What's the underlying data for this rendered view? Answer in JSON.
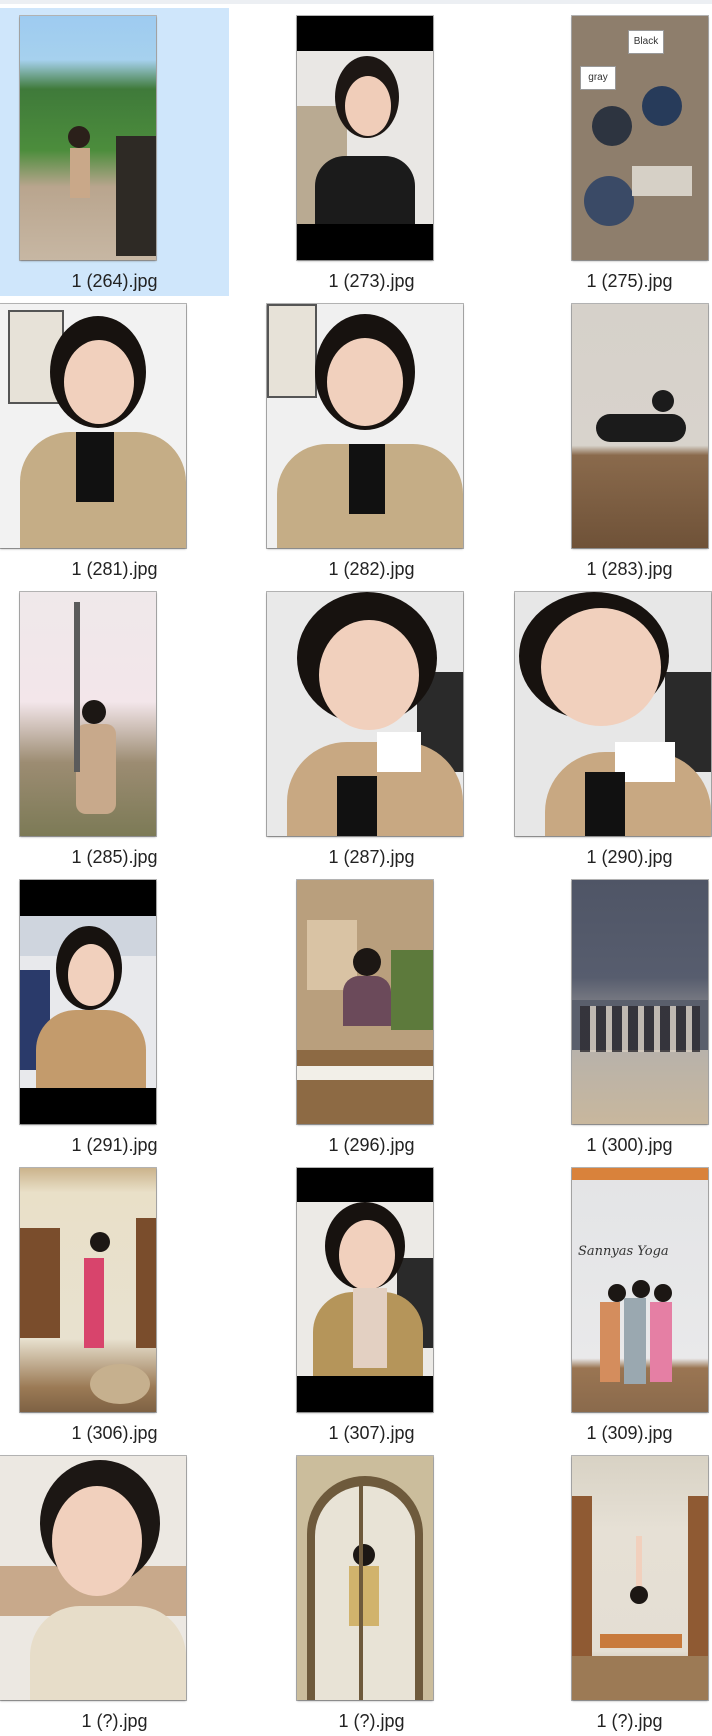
{
  "view": {
    "selected_index": 0,
    "items": [
      {
        "label": "1 (264).jpg"
      },
      {
        "label": "1 (273).jpg"
      },
      {
        "label": "1 (275).jpg"
      },
      {
        "label": "1 (281).jpg"
      },
      {
        "label": "1 (282).jpg"
      },
      {
        "label": "1 (283).jpg"
      },
      {
        "label": "1 (285).jpg"
      },
      {
        "label": "1 (287).jpg"
      },
      {
        "label": "1 (290).jpg"
      },
      {
        "label": "1 (291).jpg"
      },
      {
        "label": "1 (296).jpg"
      },
      {
        "label": "1 (300).jpg"
      },
      {
        "label": "1 (306).jpg"
      },
      {
        "label": "1 (307).jpg"
      },
      {
        "label": "1 (309).jpg"
      },
      {
        "label": "1 (?).jpg"
      },
      {
        "label": "1 (?).jpg"
      },
      {
        "label": "1 (?).jpg"
      }
    ],
    "sign_text": "Sannyas Yoga",
    "tags": [
      "gray",
      "Black"
    ]
  }
}
